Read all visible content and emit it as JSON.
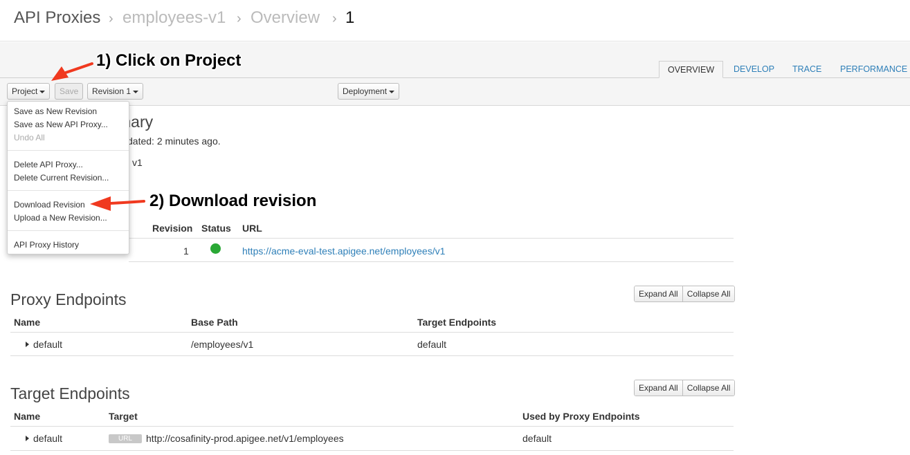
{
  "breadcrumb": {
    "items": [
      "API Proxies",
      "employees-v1",
      "Overview",
      "1"
    ],
    "separator": "›"
  },
  "tabs": [
    {
      "label": "OVERVIEW",
      "active": true
    },
    {
      "label": "DEVELOP",
      "active": false
    },
    {
      "label": "TRACE",
      "active": false
    },
    {
      "label": "PERFORMANCE",
      "active": false
    }
  ],
  "toolbar": {
    "project_label": "Project",
    "save_label": "Save",
    "revision_label": "Revision 1",
    "deployment_label": "Deployment"
  },
  "project_menu": {
    "items": [
      {
        "label": "Save as New Revision",
        "enabled": true
      },
      {
        "label": "Save as New API Proxy...",
        "enabled": true
      },
      {
        "label": "Undo All",
        "enabled": false
      },
      {
        "label": "Delete API Proxy...",
        "enabled": true
      },
      {
        "label": "Delete Current Revision...",
        "enabled": true
      },
      {
        "label": "Download Revision",
        "enabled": true
      },
      {
        "label": "Upload a New Revision...",
        "enabled": true
      },
      {
        "label": "API Proxy History",
        "enabled": true
      }
    ]
  },
  "summary": {
    "title_partial": "mary",
    "updated_partial": "dated: 2 minutes ago.",
    "version_partial": "v1"
  },
  "deployments": {
    "headers": [
      "Revision",
      "Status",
      "URL"
    ],
    "rows": [
      {
        "revision": "1",
        "status": "deployed",
        "status_color": "#2aa835",
        "url": "https://acme-eval-test.apigee.net/employees/v1"
      }
    ]
  },
  "proxy_endpoints": {
    "title": "Proxy Endpoints",
    "expand_all": "Expand All",
    "collapse_all": "Collapse All",
    "headers": [
      "Name",
      "Base Path",
      "Target Endpoints"
    ],
    "rows": [
      {
        "name": "default",
        "base_path": "/employees/v1",
        "target_endpoints": "default"
      }
    ]
  },
  "target_endpoints": {
    "title": "Target Endpoints",
    "expand_all": "Expand All",
    "collapse_all": "Collapse All",
    "headers": [
      "Name",
      "Target",
      "Used by Proxy Endpoints"
    ],
    "rows": [
      {
        "name": "default",
        "target_badge": "URL",
        "target": "http://cosafinity-prod.apigee.net/v1/employees",
        "used_by": "default"
      }
    ]
  },
  "annotations": {
    "step1": "1) Click on Project",
    "step2": "2) Download revision",
    "arrow_color": "#f0391f"
  },
  "colors": {
    "link": "#2e7fb8",
    "status_ok": "#2aa835"
  }
}
